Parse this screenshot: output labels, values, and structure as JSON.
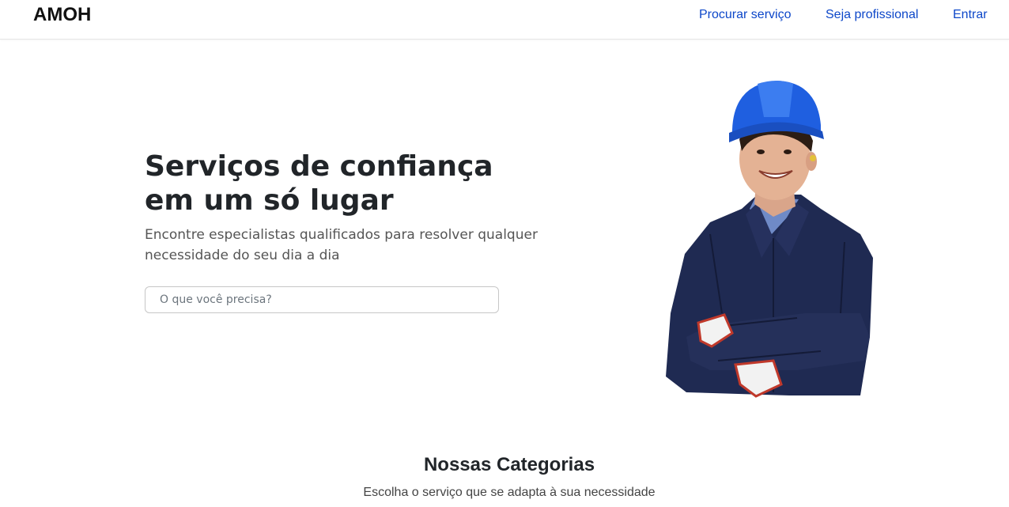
{
  "navbar": {
    "brand": "AMOH",
    "links": [
      "Procurar serviço",
      "Seja profissional",
      "Entrar"
    ]
  },
  "hero": {
    "title_line1": "Serviços de confiança",
    "title_line2": "em um só lugar",
    "subtitle_line1": "Encontre especialistas qualificados para resolver qualquer",
    "subtitle_line2": "necessidade do seu dia a dia",
    "search_placeholder": "O que você precisa?",
    "image_icon": "worker-in-hardhat-photo"
  },
  "categories": {
    "title": "Nossas Categorias",
    "subtitle": "Escolha o serviço que se adapta à sua necessidade"
  },
  "colors": {
    "link": "#0d47c9",
    "helmet": "#1f5fe0",
    "jacket": "#1f2a52"
  }
}
